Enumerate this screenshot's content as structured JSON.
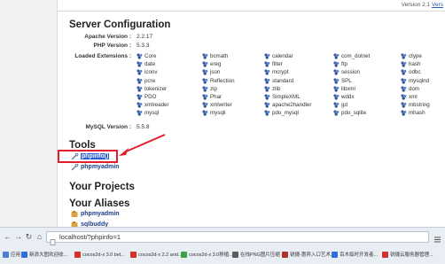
{
  "header": {
    "version_prefix": "Version 2.1",
    "version_link": "Vers"
  },
  "server": {
    "title": "Server Configuration",
    "apache_label": "Apache Version :",
    "apache_value": "2.2.17",
    "php_label": "PHP Version :",
    "php_value": "5.3.3",
    "extensions_label": "Loaded Extensions :",
    "extensions": [
      [
        "Core",
        "bcmath",
        "calendar",
        "com_dotnet",
        "ctype"
      ],
      [
        "date",
        "ereg",
        "filter",
        "ftp",
        "hash"
      ],
      [
        "iconv",
        "json",
        "mcrypt",
        "session",
        "odbc"
      ],
      [
        "pcre",
        "Reflection",
        "standard",
        "SPL",
        "mysqlnd"
      ],
      [
        "tokenizer",
        "zip",
        "zlib",
        "libxml",
        "dom"
      ],
      [
        "PDO",
        "Phar",
        "SimpleXML",
        "wddx",
        "xml"
      ],
      [
        "xmlreader",
        "xmlwriter",
        "apache2handler",
        "gd",
        "mbstring"
      ],
      [
        "mysql",
        "mysqli",
        "pdo_mysql",
        "pdo_sqlite",
        "mhash"
      ]
    ],
    "mysql_label": "MySQL Version :",
    "mysql_value": "5.5.8"
  },
  "tools": {
    "title": "Tools",
    "items": [
      "phpinfo()",
      "phpmyadmin"
    ]
  },
  "projects": {
    "title": "Your Projects"
  },
  "aliases": {
    "title": "Your Aliases",
    "items": [
      "phpmyadmin",
      "sqlbuddy"
    ]
  },
  "browser": {
    "url": "localhost/?phpinfo=1",
    "bookmarks": [
      {
        "label": "应用",
        "color": "#4a7fd4"
      },
      {
        "label": "新浪大图欢迎收...",
        "color": "#2c6fd6"
      },
      {
        "label": "cocos2d-x 3.0 bet...",
        "color": "#d6302c"
      },
      {
        "label": "cocos2d-x 2.2 and...",
        "color": "#d6302c"
      },
      {
        "label": "cocos2d-x 3.0移植...",
        "color": "#3aa34a"
      },
      {
        "label": "在线PNG图片压缩 -...",
        "color": "#5a5a5a"
      },
      {
        "label": "锐捷-惠宾入口艺术...",
        "color": "#b03030"
      },
      {
        "label": "百木临时开发者...",
        "color": "#2c6fd6"
      },
      {
        "label": "锐捷云服务器管理...",
        "color": "#d6302c"
      }
    ]
  },
  "colors": {
    "accent": "#1a3e8c",
    "highlight": "#e0202a",
    "selection": "#2b5fd0"
  }
}
